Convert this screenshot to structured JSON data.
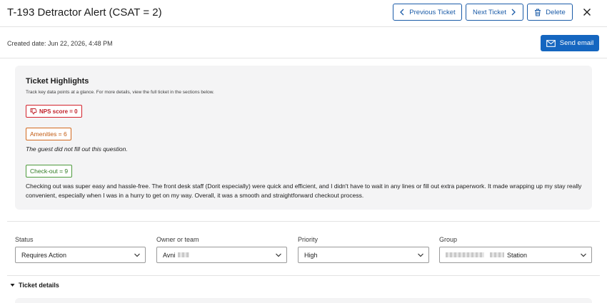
{
  "header": {
    "title": "T-193 Detractor Alert (CSAT = 2)",
    "prev_label": "Previous Ticket",
    "next_label": "Next Ticket",
    "delete_label": "Delete"
  },
  "subbar": {
    "created": "Created date: Jun 22, 2026, 4:48 PM",
    "send_label": "Send email"
  },
  "highlights": {
    "title": "Ticket Highlights",
    "subtitle": "Track key data points at a glance. For more details, view the full ticket in the sections below.",
    "nps": "NPS score = 0",
    "amenities": "Amenities = 6",
    "amenities_note": "The guest did not fill out this question.",
    "checkout": "Check-out = 9",
    "checkout_text": "Checking out was super easy and hassle-free. The front desk staff (Dorit especially) were quick and efficient, and I didn't have to wait in any lines or fill out extra paperwork. It made wrapping up my stay really convenient, especially when I was in a hurry to get on my way. Overall, it was a smooth and straightforward checkout process."
  },
  "fields": {
    "status_label": "Status",
    "status_value": "Requires Action",
    "owner_label": "Owner or team",
    "owner_value": "Avni",
    "priority_label": "Priority",
    "priority_value": "High",
    "group_label": "Group",
    "group_value": "Station"
  },
  "details": {
    "toggle_label": "Ticket details"
  },
  "colors": {
    "primary": "#1566c0",
    "nps": "#d3212b",
    "amenities": "#d2691e",
    "checkout": "#4d9a3c"
  }
}
